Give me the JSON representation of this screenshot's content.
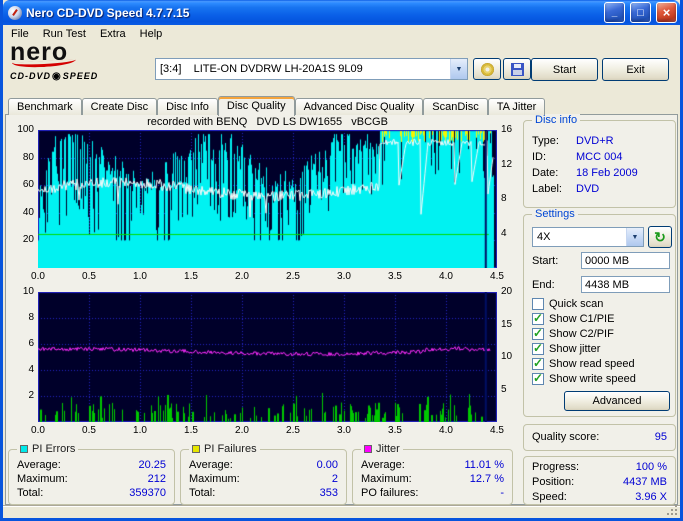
{
  "window": {
    "title": "Nero CD-DVD Speed 4.7.7.15"
  },
  "icons": {
    "minimize": "_",
    "maximize": "□",
    "close": "×",
    "dropdown": "▼",
    "check": "✓",
    "refresh": "↻",
    "disc": "◉"
  },
  "menu": {
    "items": [
      "File",
      "Run Test",
      "Extra",
      "Help"
    ]
  },
  "logo": {
    "brand": "nero",
    "product_left": "CD-DVD",
    "product_right": "SPEED"
  },
  "toolbar": {
    "drive": "[3:4]    LITE-ON DVDRW LH-20A1S 9L09",
    "start": "Start",
    "exit": "Exit"
  },
  "tabs": {
    "items": [
      "Benchmark",
      "Create Disc",
      "Disc Info",
      "Disc Quality",
      "Advanced Disc Quality",
      "ScanDisc",
      "TA Jitter"
    ],
    "active": "Disc Quality"
  },
  "chart_header": "recorded with BENQ   DVD LS DW1655   vBCGB",
  "disc_info": {
    "title": "Disc info",
    "rows": [
      {
        "label": "Type:",
        "value": "DVD+R"
      },
      {
        "label": "ID:",
        "value": "MCC 004"
      },
      {
        "label": "Date:",
        "value": "18 Feb 2009"
      },
      {
        "label": "Label:",
        "value": "DVD"
      }
    ]
  },
  "settings": {
    "title": "Settings",
    "speed": "4X",
    "start_label": "Start:",
    "start_value": "0000 MB",
    "end_label": "End:",
    "end_value": "4438 MB",
    "checkboxes": [
      {
        "label": "Quick scan",
        "checked": false
      },
      {
        "label": "Show C1/PIE",
        "checked": true
      },
      {
        "label": "Show C2/PIF",
        "checked": true
      },
      {
        "label": "Show jitter",
        "checked": true
      },
      {
        "label": "Show read speed",
        "checked": true
      },
      {
        "label": "Show write speed",
        "checked": true
      }
    ],
    "advanced": "Advanced"
  },
  "quality": {
    "label": "Quality score:",
    "value": "95"
  },
  "status_panel": {
    "rows": [
      {
        "label": "Progress:",
        "value": "100 %"
      },
      {
        "label": "Position:",
        "value": "4437 MB"
      },
      {
        "label": "Speed:",
        "value": "3.96 X"
      }
    ]
  },
  "stats": {
    "pi_errors": {
      "title": "PI Errors",
      "color": "#00E8E8",
      "rows": [
        {
          "label": "Average:",
          "value": "20.25"
        },
        {
          "label": "Maximum:",
          "value": "212"
        },
        {
          "label": "Total:",
          "value": "359370"
        }
      ]
    },
    "pi_failures": {
      "title": "PI Failures",
      "color": "#E6E600",
      "rows": [
        {
          "label": "Average:",
          "value": "0.00"
        },
        {
          "label": "Maximum:",
          "value": "2"
        },
        {
          "label": "Total:",
          "value": "353"
        }
      ]
    },
    "jitter": {
      "title": "Jitter",
      "color": "#FF00FF",
      "rows": [
        {
          "label": "Average:",
          "value": "11.01 %"
        },
        {
          "label": "Maximum:",
          "value": "12.7 %"
        },
        {
          "label": "PO failures:",
          "value": "-"
        }
      ]
    }
  },
  "chart_data": {
    "type": "line",
    "x_unit": "GB",
    "x_max": 4.5,
    "x_ticks": [
      "0.0",
      "0.5",
      "1.0",
      "1.5",
      "2.0",
      "2.5",
      "3.0",
      "3.5",
      "4.0",
      "4.5"
    ],
    "top_chart": {
      "description": "PI Errors as cyan area (left axis 0-100) with read speed green line and write speed (right axis 0-16x)",
      "left_ticks": [
        "100",
        "80",
        "60",
        "40",
        "20"
      ],
      "right_ticks": [
        "16",
        "12",
        "8",
        "4"
      ],
      "left_max": 100,
      "right_max": 16,
      "pie_avg": 20.25,
      "pie_max": 212,
      "read_speed_x": 4,
      "error_shift_gb": 3.35,
      "cursor_gb": 4.39,
      "seed": 1337
    },
    "bottom_chart": {
      "description": "PI Failures as green spikes (left axis 0-10) and jitter magenta line (right axis 0-20 %)",
      "left_ticks": [
        "10",
        "8",
        "6",
        "4",
        "2"
      ],
      "right_ticks": [
        "20",
        "15",
        "10",
        "5"
      ],
      "left_max": 10,
      "right_max": 20,
      "jitter_avg": 11.01,
      "jitter_max": 12.7,
      "pif_avg": 0.0,
      "pif_max": 2,
      "cursor_gb": 4.39,
      "seed": 2024
    }
  }
}
